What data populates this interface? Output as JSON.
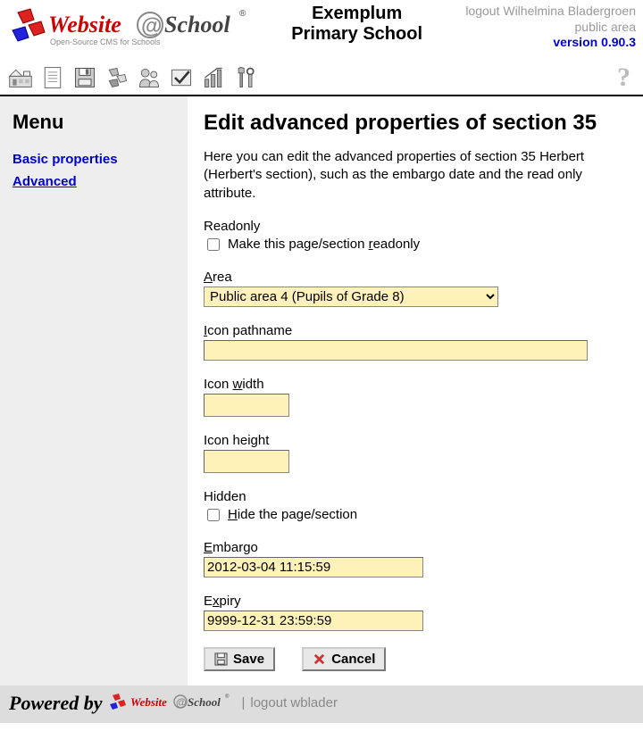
{
  "header": {
    "site_line1": "Exemplum",
    "site_line2": "Primary School",
    "logout_text": "logout Wilhelmina Bladergroen",
    "area_text": "public area",
    "version_text": "version 0.90.3"
  },
  "sidebar": {
    "title": "Menu",
    "items": [
      {
        "label": "Basic properties",
        "active": false
      },
      {
        "label": "Advanced",
        "active": true
      }
    ]
  },
  "main": {
    "heading": "Edit advanced properties of section 35",
    "intro": "Here you can edit the advanced properties of section 35 Herbert (Herbert's section), such as the embargo date and the read only attribute.",
    "readonly_group_label": "Readonly",
    "readonly_checkbox_label_pre": "Make this page/section ",
    "readonly_checkbox_label_key": "r",
    "readonly_checkbox_label_post": "eadonly",
    "readonly_checked": false,
    "area_label_key": "A",
    "area_label_rest": "rea",
    "area_selected": "Public area 4 (Pupils of Grade 8)",
    "icon_path_label_key": "I",
    "icon_path_label_rest": "con pathname",
    "icon_path_value": "",
    "icon_width_label_pre": "Icon ",
    "icon_width_label_key": "w",
    "icon_width_label_post": "idth",
    "icon_width_value": "",
    "icon_height_label_pre": "Icon hei",
    "icon_height_label_key": "g",
    "icon_height_label_post": "ht",
    "icon_height_value": "",
    "hidden_group_label": "Hidden",
    "hidden_checkbox_label_key": "H",
    "hidden_checkbox_label_post": "ide the page/section",
    "hidden_checked": false,
    "embargo_label_key": "E",
    "embargo_label_rest": "mbargo",
    "embargo_value": "2012-03-04 11:15:59",
    "expiry_label_pre": "E",
    "expiry_label_key": "x",
    "expiry_label_post": "piry",
    "expiry_value": "9999-12-31 23:59:59",
    "save_label": "Save",
    "cancel_label": "Cancel"
  },
  "footer": {
    "powered_by": "Powered by",
    "separator": "|",
    "logout_link": "logout wblader"
  }
}
